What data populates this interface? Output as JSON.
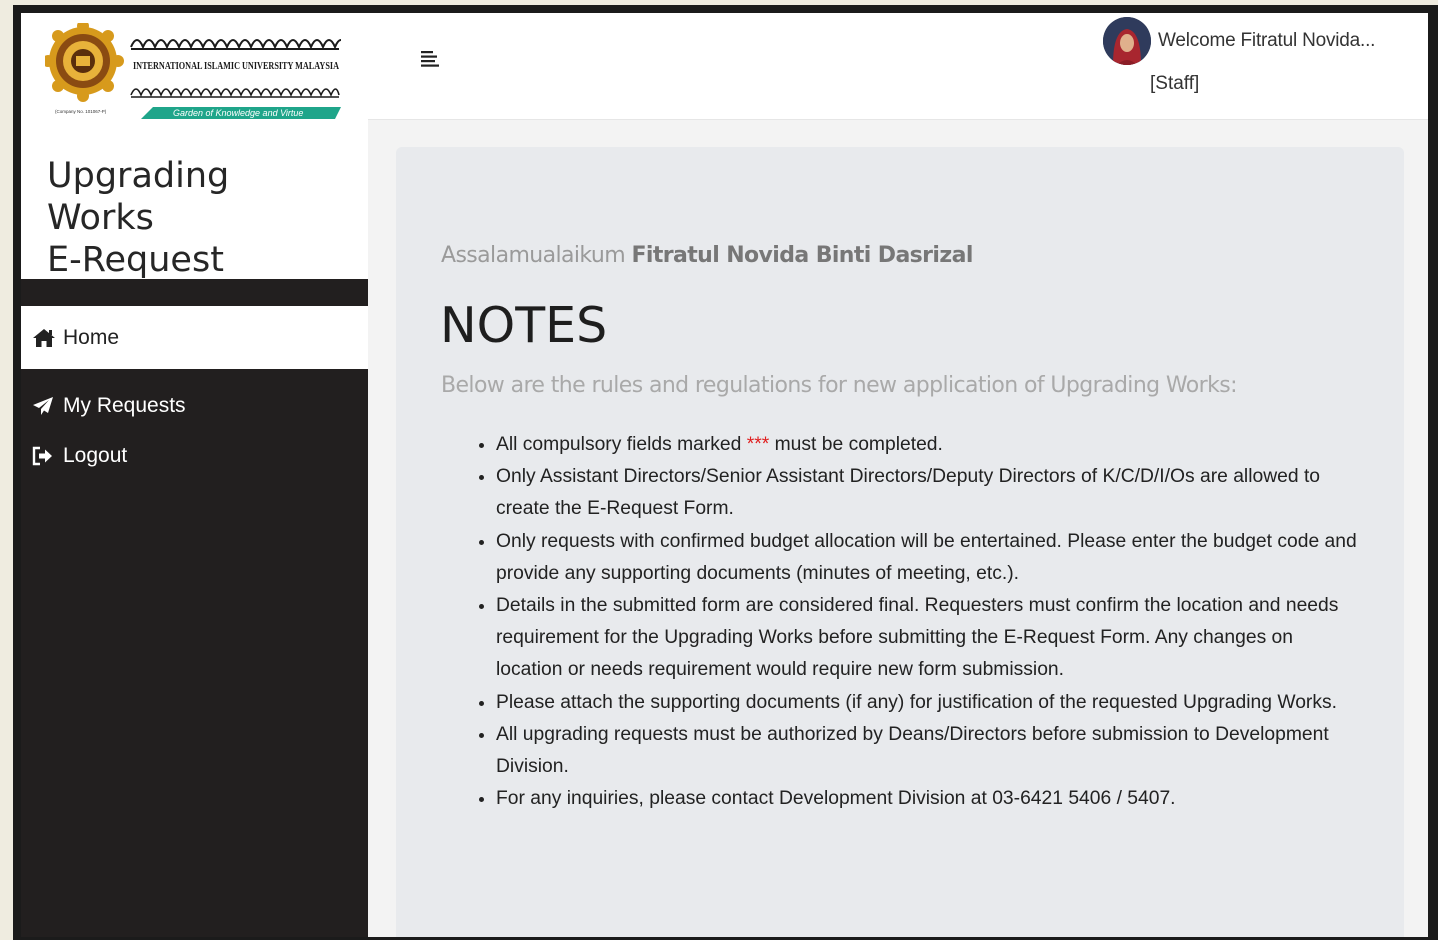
{
  "logo": {
    "arabic_line1": "الجامعة الإسلامية العالمية ماليزيا",
    "english_line": "INTERNATIONAL ISLAMIC UNIVERSITY MALAYSIA",
    "jawi_line": "يونيبرسيتي إسلام انتارابغسا مليسيا",
    "company_no": "(Company No. 101067-P)",
    "tagline": "Garden of Knowledge and Virtue"
  },
  "app": {
    "title_line1": "Upgrading Works",
    "title_line2": "E-Request"
  },
  "sidebar": {
    "items": [
      {
        "label": "Home",
        "icon": "home-icon",
        "active": true
      },
      {
        "label": "My Requests",
        "icon": "paper-plane-icon",
        "active": false
      },
      {
        "label": "Logout",
        "icon": "sign-out-icon",
        "active": false
      }
    ]
  },
  "topbar": {
    "menu_icon": "hamburger-icon",
    "welcome": "Welcome Fitratul Novida...",
    "role": "[Staff]"
  },
  "main": {
    "greeting_prefix": "Assalamualaikum",
    "greeting_name": "Fitratul Novida Binti Dasrizal",
    "notes_title": "NOTES",
    "notes_subtitle": "Below are the rules and regulations for new application of Upgrading Works:",
    "rule_1_before": "All compulsory fields marked ",
    "rule_1_mark": "***",
    "rule_1_after": " must be completed.",
    "rules": [
      "Only Assistant Directors/Senior Assistant Directors/Deputy Directors of K/C/D/I/Os are allowed to create the E-Request Form.",
      "Only requests with confirmed budget allocation will be entertained. Please enter the budget code and provide any supporting documents (minutes of meeting, etc.).",
      "Details in the submitted form are considered final. Requesters must confirm the location and needs requirement for the Upgrading Works before submitting the E-Request Form. Any changes on location or needs requirement would require new form submission.",
      "Please attach the supporting documents (if any) for justification of the requested Upgrading Works.",
      "All upgrading requests must be authorized by Deans/Directors before submission to Development Division.",
      "For any inquiries, please contact Development Division at 03-6421 5406 / 5407."
    ]
  },
  "colors": {
    "sidebar_bg": "#221f1f",
    "card_bg": "#e8eaed",
    "required_mark": "#e02020",
    "logo_green": "#1fa58a",
    "logo_gold": "#d79a1c"
  }
}
